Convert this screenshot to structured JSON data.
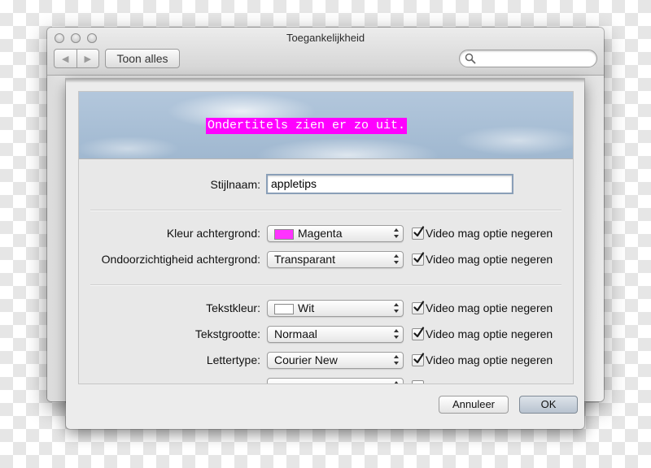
{
  "window": {
    "title": "Toegankelijkheid",
    "show_all_label": "Toon alles",
    "search_placeholder": ""
  },
  "preview": {
    "sample_text": "Ondertitels zien er zo uit.",
    "text_color": "#ffffff",
    "background_color": "#ff00ff"
  },
  "form": {
    "style_name_label": "Stijlnaam:",
    "style_name_value": "appletips",
    "checkbox_label": "Video mag optie negeren",
    "rows": [
      {
        "label": "Kleur achtergrond:",
        "value": "Magenta",
        "swatch": "#ff33ff",
        "checked": true
      },
      {
        "label": "Ondoorzichtigheid achtergrond:",
        "value": "Transparant",
        "checked": true
      },
      {
        "label": "Tekstkleur:",
        "value": "Wit",
        "swatch": "#ffffff",
        "checked": true
      },
      {
        "label": "Tekstgrootte:",
        "value": "Normaal",
        "checked": true
      },
      {
        "label": "Lettertype:",
        "value": "Courier New",
        "checked": true
      }
    ]
  },
  "buttons": {
    "cancel": "Annuleer",
    "ok": "OK"
  }
}
